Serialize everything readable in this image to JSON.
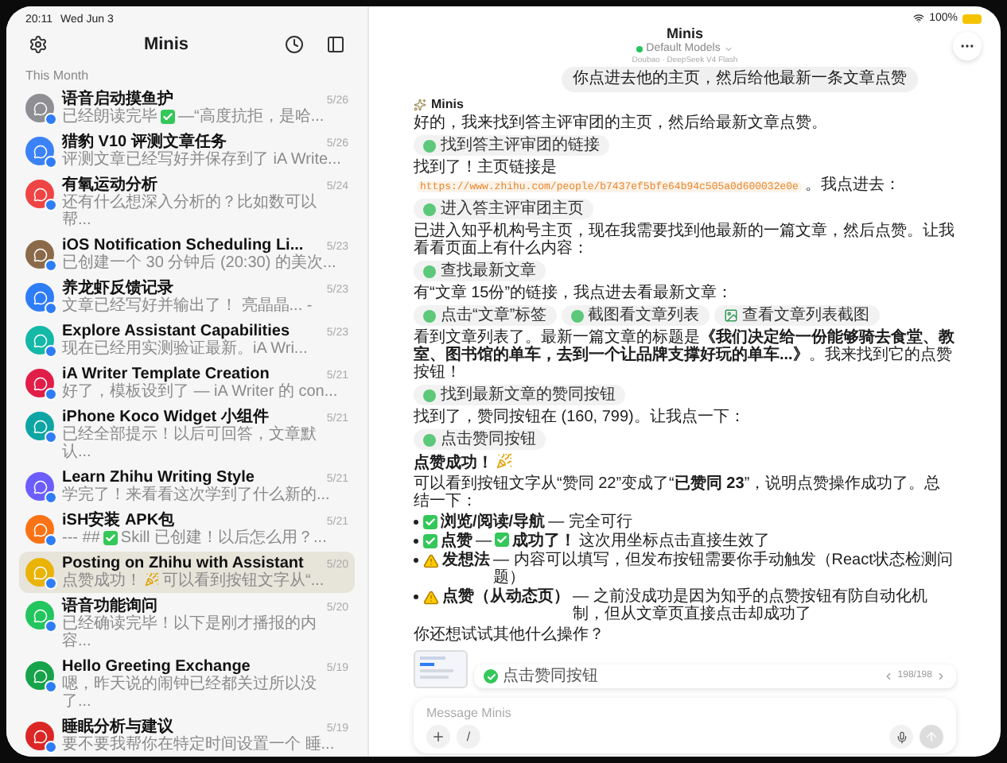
{
  "sidebar": {
    "status_time": "20:11",
    "status_date": "Wed Jun 3",
    "title": "Minis",
    "section": "This Month",
    "chats": [
      {
        "title": "语音启动摸鱼护",
        "preview": [
          {
            "kind": "text",
            "text": "已经朗读完毕"
          },
          {
            "kind": "check"
          },
          {
            "kind": "text",
            "text": "—“高度抗拒，是哈..."
          }
        ],
        "date": "5/26",
        "color": "#8e8e93",
        "selected": false
      },
      {
        "title": "猎豹 V10 评测文章任务",
        "preview": [
          {
            "kind": "text",
            "text": "评测文章已经写好并保存到了 iA Write..."
          }
        ],
        "date": "5/26",
        "color": "#3b82f6",
        "selected": false
      },
      {
        "title": "有氧运动分析",
        "preview": [
          {
            "kind": "text",
            "text": "还有什么想深入分析的？比如数可以帮..."
          }
        ],
        "date": "5/24",
        "color": "#ef4444",
        "selected": false
      },
      {
        "title": "iOS Notification Scheduling Li...",
        "preview": [
          {
            "kind": "text",
            "text": "已创建一个 30 分钟后 (20:30) 的美次..."
          }
        ],
        "date": "5/23",
        "color": "#8b6a4a",
        "selected": false
      },
      {
        "title": "养龙虾反馈记录",
        "preview": [
          {
            "kind": "text",
            "text": "文章已经写好并输出了！ 亮晶晶... -"
          }
        ],
        "date": "5/23",
        "color": "#2f7df6",
        "selected": false
      },
      {
        "title": "Explore Assistant Capabilities",
        "preview": [
          {
            "kind": "text",
            "text": "现在已经用实测验证最新。iA Wri..."
          }
        ],
        "date": "5/23",
        "color": "#14b8a6",
        "selected": false
      },
      {
        "title": "iA Writer Template Creation",
        "preview": [
          {
            "kind": "text",
            "text": "好了，模板设到了 — iA Writer 的 con..."
          }
        ],
        "date": "5/21",
        "color": "#e11d48",
        "selected": false
      },
      {
        "title": "iPhone Koco Widget 小组件",
        "preview": [
          {
            "kind": "text",
            "text": "已经全部提示！以后可回答，文章默认..."
          }
        ],
        "date": "5/21",
        "color": "#0ea5a4",
        "selected": false
      },
      {
        "title": "Learn Zhihu Writing Style",
        "preview": [
          {
            "kind": "text",
            "text": "学完了！来看看这次学到了什么新的..."
          }
        ],
        "date": "5/21",
        "color": "#6d5dfc",
        "selected": false
      },
      {
        "title": "iSH安装 APK包",
        "preview": [
          {
            "kind": "text",
            "text": "--- ##"
          },
          {
            "kind": "check"
          },
          {
            "kind": "text",
            "text": "Skill 已创建！以后怎么用？..."
          }
        ],
        "date": "5/21",
        "color": "#f97316",
        "selected": false
      },
      {
        "title": "Posting on Zhihu with Assistant",
        "preview": [
          {
            "kind": "text",
            "text": "点赞成功！"
          },
          {
            "kind": "party"
          },
          {
            "kind": "text",
            "text": "可以看到按钮文字从“..."
          }
        ],
        "date": "5/20",
        "color": "#eab308",
        "selected": true
      },
      {
        "title": "语音功能询问",
        "preview": [
          {
            "kind": "text",
            "text": "已经确读完毕！以下是刚才播报的内容..."
          }
        ],
        "date": "5/20",
        "color": "#22c55e",
        "selected": false
      },
      {
        "title": "Hello Greeting Exchange",
        "preview": [
          {
            "kind": "text",
            "text": "嗯，昨天说的闹钟已经都关过所以没了..."
          }
        ],
        "date": "5/19",
        "color": "#16a34a",
        "selected": false
      },
      {
        "title": "睡眠分析与建议",
        "preview": [
          {
            "kind": "text",
            "text": "要不要我帮你在特定时间设置一个 睡..."
          }
        ],
        "date": "5/19",
        "color": "#dc2626",
        "selected": false
      }
    ]
  },
  "chat": {
    "status_battery": "100%",
    "title": "Minis",
    "model": "Default Models",
    "model_online": true,
    "subtitle": "Doubao · DeepSeek V4 Flash",
    "user_message": "你点进去他的主页，然后给他最新一条文章点赞",
    "assistant_name": "Minis",
    "blocks": [
      {
        "kind": "text",
        "parts": [
          {
            "kind": "text",
            "text": "好的，我来找到答主评审团的主页，然后给最新文章点赞。"
          }
        ]
      },
      {
        "kind": "steps",
        "items": [
          {
            "kind": "tool",
            "label": "找到答主评审团的链接"
          }
        ]
      },
      {
        "kind": "text",
        "parts": [
          {
            "kind": "text",
            "text": "找到了！主页链接是"
          },
          {
            "kind": "code",
            "text": "https://www.zhihu.com/people/b7437ef5bfe64b94c505a0d600032e0e"
          },
          {
            "kind": "text",
            "text": "。我点进去："
          }
        ]
      },
      {
        "kind": "steps",
        "items": [
          {
            "kind": "tool",
            "label": "进入答主评审团主页"
          }
        ]
      },
      {
        "kind": "text",
        "parts": [
          {
            "kind": "text",
            "text": "已进入知乎机构号主页，现在我需要找到他最新的一篇文章，然后点赞。让我看看页面上有什么内容："
          }
        ]
      },
      {
        "kind": "steps",
        "items": [
          {
            "kind": "tool",
            "label": "查找最新文章"
          }
        ]
      },
      {
        "kind": "text",
        "parts": [
          {
            "kind": "text",
            "text": "有“文章 15份”的链接，我点进去看最新文章："
          }
        ]
      },
      {
        "kind": "steps",
        "items": [
          {
            "kind": "tool",
            "label": "点击“文章”标签"
          },
          {
            "kind": "tool",
            "label": "截图看文章列表"
          },
          {
            "kind": "image",
            "label": "查看文章列表截图"
          }
        ]
      },
      {
        "kind": "text",
        "parts": [
          {
            "kind": "text",
            "text": "看到文章列表了。最新一篇文章的标题是**《我们决定给一份能够骑去食堂、教室、图书馆的单车，去到一个让品牌支撑好玩的单车...》**。我来找到它的点赞按钮！"
          }
        ]
      },
      {
        "kind": "steps",
        "items": [
          {
            "kind": "tool",
            "label": "找到最新文章的赞同按钮"
          }
        ]
      },
      {
        "kind": "text",
        "parts": [
          {
            "kind": "text",
            "text": "找到了，赞同按钮在 (160, 799)。让我点一下："
          }
        ]
      },
      {
        "kind": "steps",
        "items": [
          {
            "kind": "tool",
            "label": "点击赞同按钮"
          }
        ]
      },
      {
        "kind": "text",
        "parts": [
          {
            "kind": "strong",
            "text": "点赞成功！"
          },
          {
            "kind": "party"
          }
        ]
      },
      {
        "kind": "text",
        "parts": [
          {
            "kind": "text",
            "text": "可以看到按钮文字从“赞同 22”变成了“**已赞同 23**”，说明点赞操作成功了。总结一下："
          }
        ]
      },
      {
        "kind": "bullets",
        "items": [
          {
            "parts": [
              {
                "kind": "check"
              },
              {
                "kind": "strong",
                "text": "浏览/阅读/导航"
              },
              {
                "kind": "text",
                "text": "— 完全可行"
              }
            ]
          },
          {
            "parts": [
              {
                "kind": "check"
              },
              {
                "kind": "strong",
                "text": "点赞"
              },
              {
                "kind": "text",
                "text": "—"
              },
              {
                "kind": "check"
              },
              {
                "kind": "strong",
                "text": "成功了！"
              },
              {
                "kind": "text",
                "text": "这次用坐标点击直接生效了"
              }
            ]
          },
          {
            "parts": [
              {
                "kind": "warn"
              },
              {
                "kind": "strong",
                "text": "发想法"
              },
              {
                "kind": "text",
                "text": "— 内容可以填写，但发布按钮需要你手动触发（React状态检测问题）"
              }
            ]
          },
          {
            "parts": [
              {
                "kind": "warn"
              },
              {
                "kind": "strong",
                "text": "点赞（从动态页）"
              },
              {
                "kind": "text",
                "text": "— 之前没成功是因为知乎的点赞按钮有防自动化机制，但从文章页直接点击却成功了"
              }
            ]
          }
        ]
      },
      {
        "kind": "text",
        "parts": [
          {
            "kind": "text",
            "text": "你还想试试其他什么操作？"
          }
        ]
      }
    ],
    "step_bar": {
      "label": "点击赞同按钮",
      "done": true,
      "counter": "198/198"
    },
    "composer": {
      "placeholder": "Message Minis",
      "slash_label": "/"
    }
  }
}
